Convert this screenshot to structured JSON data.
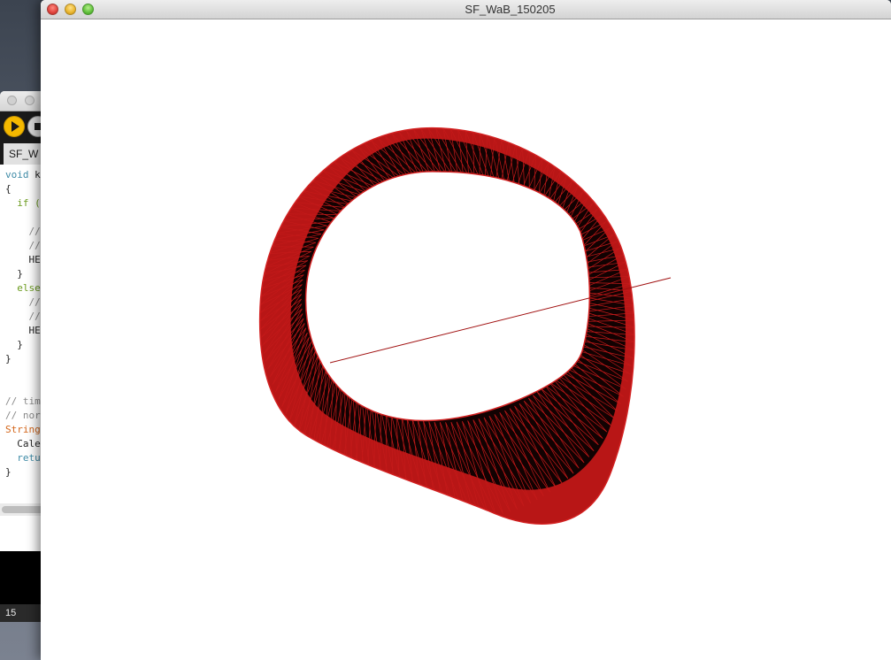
{
  "sketch_window": {
    "title": "SF_WaB_150205"
  },
  "ide_window": {
    "tab_label": "SF_W",
    "code_lines": [
      {
        "parts": [
          {
            "t": "void ",
            "c": "kw"
          },
          {
            "t": "k",
            "c": ""
          }
        ]
      },
      {
        "parts": [
          {
            "t": "{",
            "c": ""
          }
        ]
      },
      {
        "parts": [
          {
            "t": "  if (",
            "c": "kw2"
          }
        ]
      },
      {
        "parts": [
          {
            "t": "",
            "c": ""
          }
        ]
      },
      {
        "parts": [
          {
            "t": "    //",
            "c": "cmt"
          }
        ]
      },
      {
        "parts": [
          {
            "t": "    //",
            "c": "cmt"
          }
        ]
      },
      {
        "parts": [
          {
            "t": "    HE",
            "c": ""
          }
        ]
      },
      {
        "parts": [
          {
            "t": "  }",
            "c": ""
          }
        ]
      },
      {
        "parts": [
          {
            "t": "  else",
            "c": "kw2"
          }
        ]
      },
      {
        "parts": [
          {
            "t": "    //",
            "c": "cmt"
          }
        ]
      },
      {
        "parts": [
          {
            "t": "    //",
            "c": "cmt"
          }
        ]
      },
      {
        "parts": [
          {
            "t": "    HE",
            "c": ""
          }
        ]
      },
      {
        "parts": [
          {
            "t": "  }",
            "c": ""
          }
        ]
      },
      {
        "parts": [
          {
            "t": "}",
            "c": ""
          }
        ]
      },
      {
        "parts": [
          {
            "t": "",
            "c": ""
          }
        ]
      },
      {
        "parts": [
          {
            "t": "",
            "c": ""
          }
        ]
      },
      {
        "parts": [
          {
            "t": "// tim",
            "c": "cmt"
          }
        ]
      },
      {
        "parts": [
          {
            "t": "// nor",
            "c": "cmt"
          }
        ]
      },
      {
        "parts": [
          {
            "t": "String",
            "c": "typ"
          }
        ]
      },
      {
        "parts": [
          {
            "t": "  Cale",
            "c": ""
          }
        ]
      },
      {
        "parts": [
          {
            "t": "  retu",
            "c": "kw"
          }
        ]
      },
      {
        "parts": [
          {
            "t": "}",
            "c": ""
          }
        ]
      }
    ],
    "status_line": "15"
  },
  "render": {
    "mesh_color": "#c41a1a",
    "mesh_dark": "#0a0000",
    "axis_line_color": "#a01010"
  }
}
